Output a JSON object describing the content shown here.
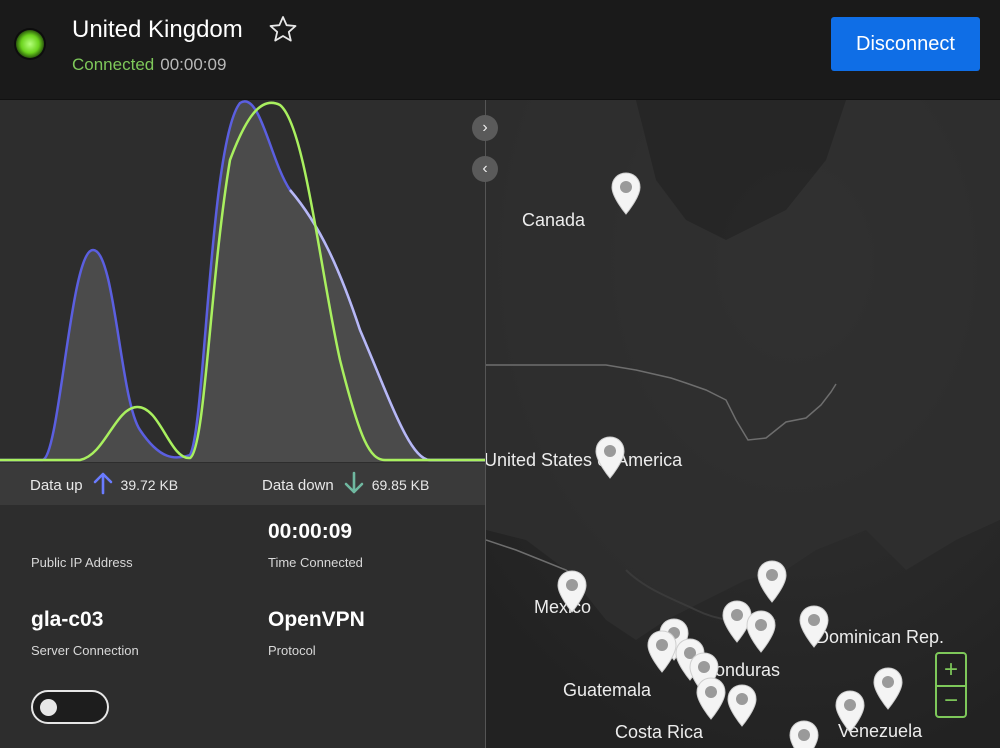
{
  "header": {
    "country": "United Kingdom",
    "status": "Connected",
    "elapsed": "00:00:09",
    "disconnect_label": "Disconnect"
  },
  "graph": {
    "series_up_color": "#5b5fe0",
    "series_down_color": "#a9f05f"
  },
  "stats": {
    "data_up_label": "Data up",
    "data_up_value": "39.72 KB",
    "data_down_label": "Data down",
    "data_down_value": "69.85 KB"
  },
  "info": {
    "public_ip_value": "",
    "public_ip_label": "Public IP Address",
    "time_value": "00:00:09",
    "time_label": "Time Connected",
    "server_value": "gla-c03",
    "server_label": "Server Connection",
    "protocol_value": "OpenVPN",
    "protocol_label": "Protocol"
  },
  "map": {
    "labels": {
      "canada": "Canada",
      "usa": "United States of America",
      "mexico": "Mexico",
      "guatemala": "Guatemala",
      "honduras": "Honduras",
      "dominican": "Dominican Rep.",
      "costa_rica": "Costa Rica",
      "venezuela": "Venezuela"
    },
    "zoom_in": "+",
    "zoom_out": "−"
  },
  "colors": {
    "accent_blue": "#0f6ee6",
    "connected_green": "#7ec85a",
    "down_arrow": "#6fb8a0",
    "up_arrow": "#6a7bff"
  }
}
